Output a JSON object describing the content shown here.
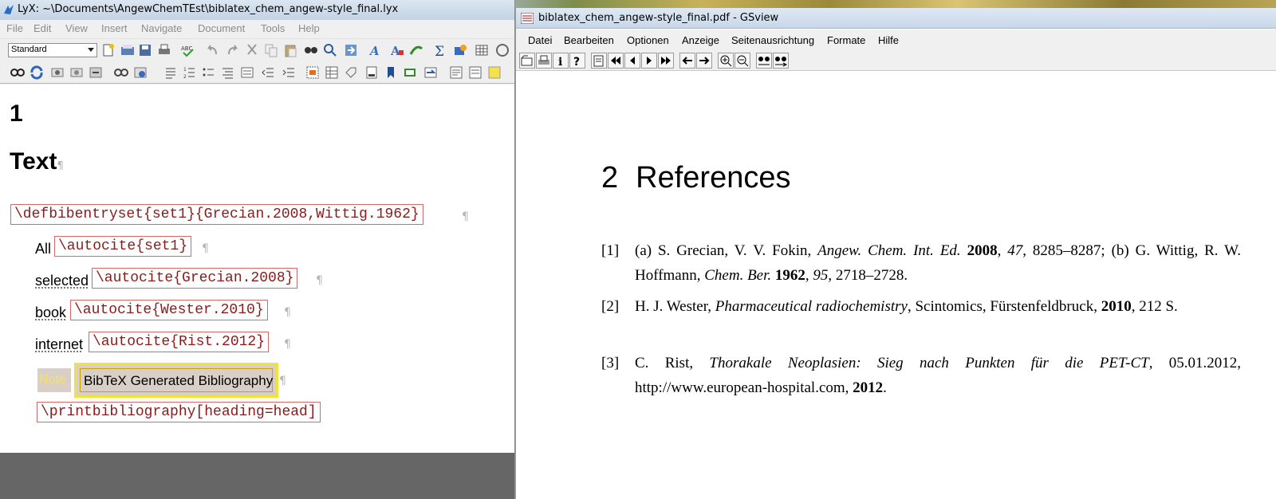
{
  "lyx": {
    "window_title": "LyX: ~\\Documents\\AngewChemTEst\\biblatex_chem_angew-style_final.lyx",
    "menu": [
      "File",
      "Edit",
      "View",
      "Insert",
      "Navigate",
      "Document",
      "Tools",
      "Help"
    ],
    "paragraph_style": "Standard",
    "document": {
      "section_number": "1",
      "section_title": "Text",
      "pilcrow": "¶",
      "ert_defbib": "\\defbibentryset{set1}{Grecian.2008,Wittig.1962}",
      "rows": [
        {
          "label": "All",
          "code": "\\autocite{set1}"
        },
        {
          "label": "selected",
          "code": "\\autocite{Grecian.2008}"
        },
        {
          "label": "book",
          "code": "\\autocite{Wester.2010}"
        },
        {
          "label": "internet",
          "code": "\\autocite{Rist.2012}"
        }
      ],
      "note_label": "Note",
      "bibliography_inset": "BibTeX Generated Bibliography",
      "ert_print": "\\printbibliography[heading=head]"
    }
  },
  "gsview": {
    "window_title": "biblatex_chem_angew-style_final.pdf - GSview",
    "menu": [
      "Datei",
      "Bearbeiten",
      "Optionen",
      "Anzeige",
      "Seitenausrichtung",
      "Formate",
      "Hilfe"
    ],
    "toolbar_icons": [
      "open-icon",
      "print-icon",
      "info-icon",
      "help-icon",
      "page-select-icon",
      "first-page-icon",
      "prev-page-icon",
      "next-page-icon",
      "last-page-icon",
      "back-icon",
      "forward-icon",
      "zoom-in-icon",
      "zoom-out-icon",
      "find-icon",
      "find-next-icon"
    ],
    "heading_number": "2",
    "heading_title": "References",
    "references": [
      {
        "label": "[1]",
        "parts": [
          {
            "t": "(a) S. Grecian, V. V. Fokin, ",
            "s": ""
          },
          {
            "t": "Angew. Chem. Int. Ed.",
            "s": "i"
          },
          {
            "t": " ",
            "s": ""
          },
          {
            "t": "2008",
            "s": "b"
          },
          {
            "t": ", ",
            "s": ""
          },
          {
            "t": "47",
            "s": "i"
          },
          {
            "t": ", 8285–8287; (b) G. Wittig, R. W. Hoffmann, ",
            "s": ""
          },
          {
            "t": "Chem. Ber.",
            "s": "i"
          },
          {
            "t": " ",
            "s": ""
          },
          {
            "t": "1962",
            "s": "b"
          },
          {
            "t": ", ",
            "s": ""
          },
          {
            "t": "95",
            "s": "i"
          },
          {
            "t": ", 2718–2728.",
            "s": ""
          }
        ]
      },
      {
        "label": "[2]",
        "parts": [
          {
            "t": "H. J. Wester, ",
            "s": ""
          },
          {
            "t": "Pharmaceutical radiochemistry",
            "s": "i"
          },
          {
            "t": ", Scintomics, Fürstenfeldbruck, ",
            "s": ""
          },
          {
            "t": "2010",
            "s": "b"
          },
          {
            "t": ", 212 S.",
            "s": ""
          }
        ]
      },
      {
        "label": "[3]",
        "parts": [
          {
            "t": "C. Rist, ",
            "s": ""
          },
          {
            "t": "Thorakale Neoplasien: Sieg nach Punkten für die PET-CT",
            "s": "i"
          },
          {
            "t": ", 05.01.2012, http://www.european-hospital.com, ",
            "s": ""
          },
          {
            "t": "2012",
            "s": "b"
          },
          {
            "t": ".",
            "s": ""
          }
        ]
      }
    ]
  }
}
